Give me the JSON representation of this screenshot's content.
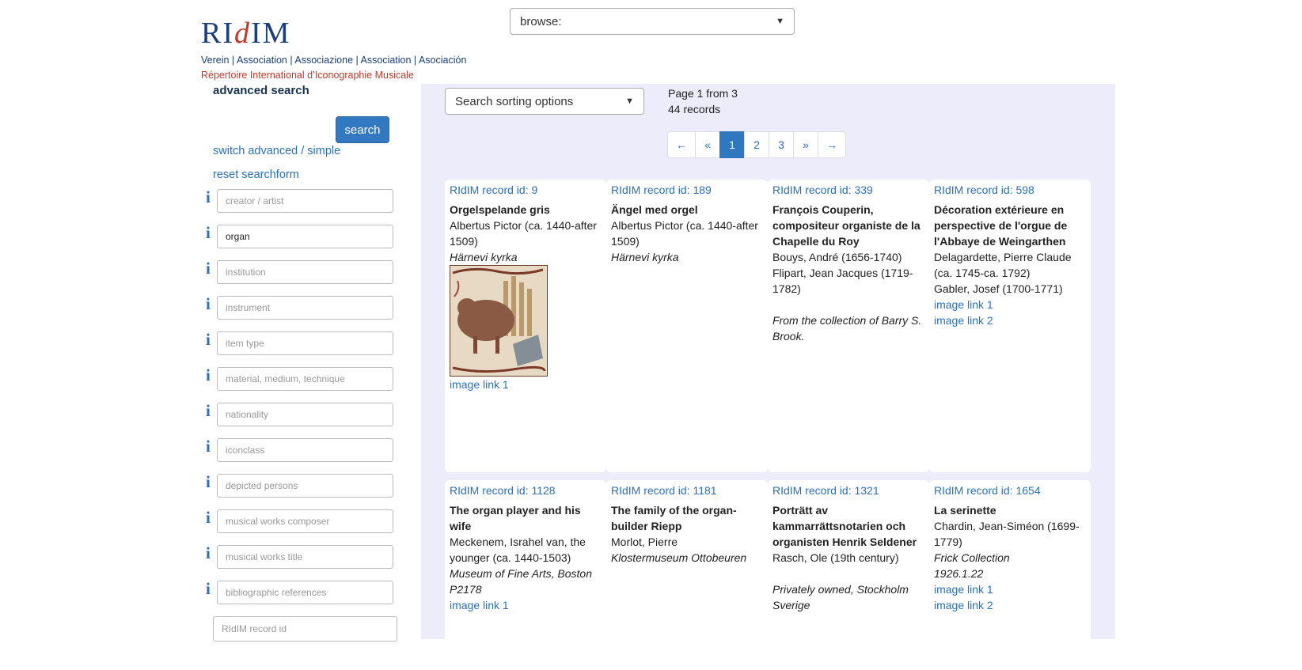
{
  "logo": {
    "wordmark_left": "RI",
    "wordmark_d": "d",
    "wordmark_right": "IM",
    "associations": "Verein | Association | Associazione | Association | Asociación",
    "subtitle": "Répertoire International d’Iconographie Musicale"
  },
  "browse": {
    "label": "browse:"
  },
  "sidebar": {
    "title": "advanced search",
    "search_button": "search",
    "switch_link": "switch advanced / simple",
    "reset_link": "reset searchform",
    "info_glyph": "i",
    "fields": [
      {
        "placeholder": "creator / artist",
        "value": ""
      },
      {
        "placeholder": "",
        "value": "organ"
      },
      {
        "placeholder": "institution",
        "value": ""
      },
      {
        "placeholder": "instrument",
        "value": ""
      },
      {
        "placeholder": "item type",
        "value": ""
      },
      {
        "placeholder": "material, medium, technique",
        "value": ""
      },
      {
        "placeholder": "nationality",
        "value": ""
      },
      {
        "placeholder": "iconclass",
        "value": ""
      },
      {
        "placeholder": "depicted persons",
        "value": ""
      },
      {
        "placeholder": "musical works composer",
        "value": ""
      },
      {
        "placeholder": "musical works title",
        "value": ""
      },
      {
        "placeholder": "bibliographic references",
        "value": ""
      }
    ],
    "rid_placeholder": "RIdIM record id"
  },
  "results": {
    "sort_label": "Search sorting options",
    "page_line": "Page 1 from 3",
    "count_line": "44 records",
    "pagination": [
      "←",
      "«",
      "1",
      "2",
      "3",
      "»",
      "→"
    ],
    "active_page": "1",
    "cards": [
      {
        "rid": "RIdIM record id: 9",
        "title": "Orgelspelande gris",
        "creators": [
          "Albertus Pictor (ca. 1440-after 1509)"
        ],
        "location": [
          "Härnevi kyrka"
        ],
        "has_image": true,
        "links": [
          "image link 1"
        ]
      },
      {
        "rid": "RIdIM record id: 189",
        "title": "Ängel med orgel",
        "creators": [
          "Albertus Pictor (ca. 1440-after 1509)"
        ],
        "location": [
          "Härnevi kyrka"
        ],
        "has_image": false,
        "links": []
      },
      {
        "rid": "RIdIM record id: 339",
        "title": "François Couperin, compositeur organiste de la Chapelle du Roy",
        "creators": [
          "Bouys, André (1656-1740)",
          "Flipart, Jean Jacques (1719-1782)"
        ],
        "gap": true,
        "location": [
          "From the collection of Barry S. Brook."
        ],
        "has_image": false,
        "links": []
      },
      {
        "rid": "RIdIM record id: 598",
        "title": "Décoration extérieure en perspective de l'orgue de l'Abbaye de Weingarthen",
        "creators": [
          "Delagardette, Pierre Claude (ca. 1745-ca. 1792)",
          "Gabler, Josef (1700-1771)"
        ],
        "location": [],
        "has_image": false,
        "links": [
          "image link 1",
          "image link 2"
        ]
      },
      {
        "rid": "RIdIM record id: 1128",
        "title": "The organ player and his wife",
        "creators": [
          "Meckenem, Israhel van, the younger (ca. 1440-1503)"
        ],
        "location": [
          "Museum of Fine Arts, Boston",
          "P2178"
        ],
        "has_image": false,
        "links": [
          "image link 1"
        ]
      },
      {
        "rid": "RIdIM record id: 1181",
        "title": "The family of the organ-builder Riepp",
        "creators": [
          "Morlot, Pierre"
        ],
        "location": [
          "Klostermuseum Ottobeuren"
        ],
        "has_image": false,
        "links": []
      },
      {
        "rid": "RIdIM record id: 1321",
        "title": "Porträtt av kammarrättsnotarien och organisten Henrik Seldener",
        "creators": [
          "Rasch, Ole (19th century)"
        ],
        "gap": true,
        "location": [
          "Privately owned, Stockholm Sverige"
        ],
        "has_image": false,
        "links": []
      },
      {
        "rid": "RIdIM record id: 1654",
        "title": "La serinette",
        "creators": [
          "Chardin, Jean-Siméon (1699-1779)"
        ],
        "location": [
          "Frick Collection",
          "1926.1.22"
        ],
        "has_image": false,
        "links": [
          "image link 1",
          "image link 2"
        ]
      }
    ]
  }
}
